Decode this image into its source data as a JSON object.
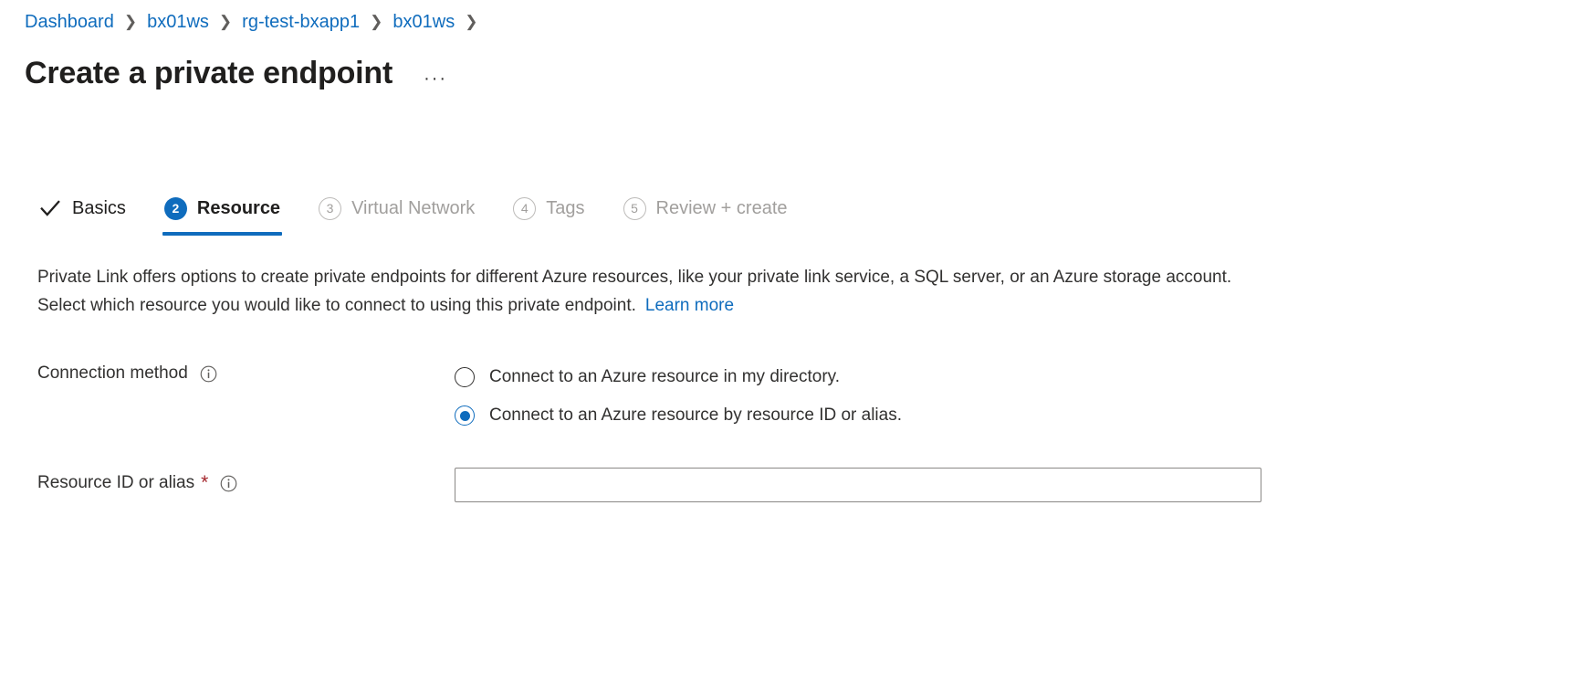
{
  "breadcrumb": {
    "separator": "❯",
    "items": [
      {
        "label": "Dashboard"
      },
      {
        "label": "bx01ws"
      },
      {
        "label": "rg-test-bxapp1"
      },
      {
        "label": "bx01ws"
      }
    ]
  },
  "header": {
    "title": "Create a private endpoint",
    "more_label": "···"
  },
  "wizard": {
    "tabs": [
      {
        "badge": "✓",
        "label": "Basics",
        "state": "done"
      },
      {
        "badge": "2",
        "label": "Resource",
        "state": "active"
      },
      {
        "badge": "3",
        "label": "Virtual Network",
        "state": "disabled"
      },
      {
        "badge": "4",
        "label": "Tags",
        "state": "disabled"
      },
      {
        "badge": "5",
        "label": "Review + create",
        "state": "disabled"
      }
    ]
  },
  "main": {
    "description": "Private Link offers options to create private endpoints for different Azure resources, like your private link service, a SQL server, or an Azure storage account. Select which resource you would like to connect to using this private endpoint.",
    "learn_more_label": "Learn more",
    "connection_method": {
      "label": "Connection method",
      "info_icon": "info-icon",
      "options": [
        {
          "label": "Connect to an Azure resource in my directory.",
          "selected": false
        },
        {
          "label": "Connect to an Azure resource by resource ID or alias.",
          "selected": true
        }
      ]
    },
    "resource_id": {
      "label": "Resource ID or alias",
      "required_marker": "*",
      "info_icon": "info-icon",
      "value": "",
      "placeholder": ""
    }
  },
  "colors": {
    "accent": "#0f6cbd",
    "link": "#0f6cbd",
    "required": "#a4262c",
    "disabled_text": "#a19f9d",
    "body_text": "#323130",
    "input_border": "#8a8886"
  }
}
